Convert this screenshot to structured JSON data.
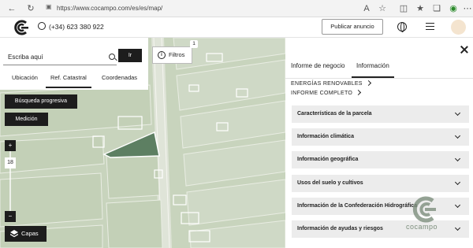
{
  "browser": {
    "url": "https://www.cocampo.com/es/es/map/",
    "icons": [
      "back-icon",
      "refresh-icon",
      "lock-icon",
      "read-aloud-icon",
      "favorite-icon",
      "split-screen-icon",
      "favorites-bar-icon",
      "collections-icon",
      "extensions-icon",
      "more-icon"
    ]
  },
  "header": {
    "phone": "(+34) 623 380 922",
    "publish_label": "Publicar anuncio"
  },
  "search": {
    "placeholder": "Escriba aquí",
    "go_label": "Ir",
    "tabs": [
      "Ubicación",
      "Ref. Catastral",
      "Coordenadas"
    ],
    "active_tab": "Ref. Catastral"
  },
  "map": {
    "filters_label": "Filtros",
    "filters_count": "1",
    "progressive_search_label": "Búsqueda progresiva",
    "measure_label": "Medición",
    "zoom_in": "+",
    "zoom_level": "18",
    "zoom_out": "−",
    "layers_label": "Capas"
  },
  "panel": {
    "tabs": [
      "Informe de negocio",
      "Información"
    ],
    "active_tab": "Información",
    "links": [
      "ENERGÍAS RENOVABLES",
      "INFORME COMPLETO"
    ],
    "sections": [
      "Características de la parcela",
      "Información climática",
      "Información geográfica",
      "Usos del suelo y cultivos",
      "Información de la Confederación Hidrográfica",
      "Información de ayudas y riesgos"
    ],
    "watermark": "cocampo"
  },
  "colors": {
    "brand_dark": "#1d1d1d",
    "map_green": "#c9d5bf",
    "accordion_bg": "#ececec"
  }
}
